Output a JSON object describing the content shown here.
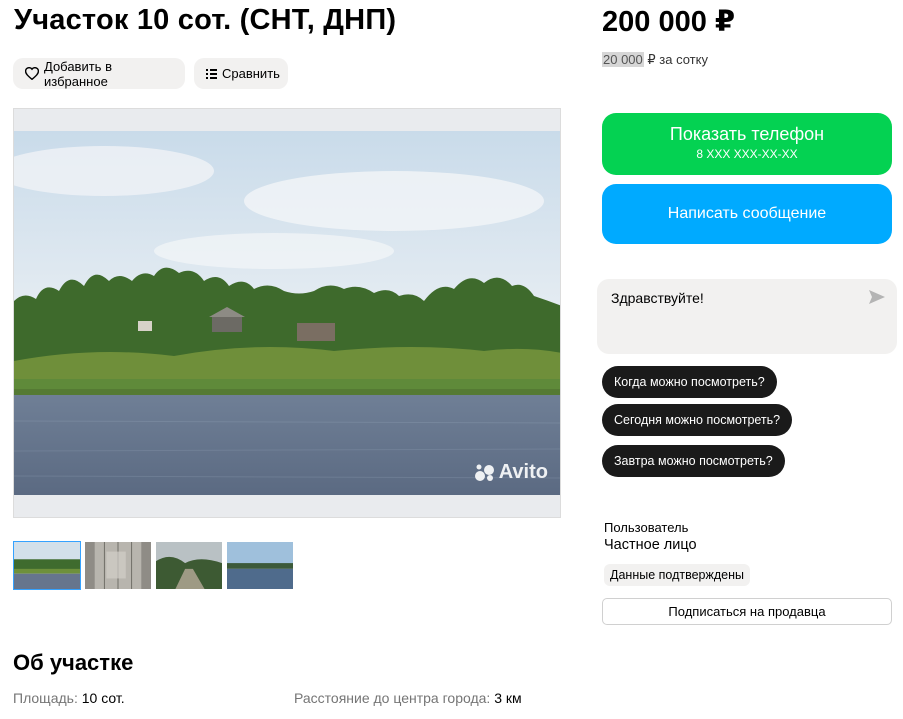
{
  "listing": {
    "title": "Участок 10 сот. (СНТ, ДНП)",
    "favorite_label": "Добавить в избранное",
    "compare_label": "Сравнить",
    "watermark": "Avito",
    "thumbnail_count": 4,
    "active_thumbnail": 1
  },
  "pricing": {
    "price": "200 000 ₽",
    "per_unit_value": "20 000",
    "per_unit_suffix": "₽ за сотку"
  },
  "contact": {
    "phone_button_label": "Показать телефон",
    "phone_masked": "8 XXX XXX-XX-XX",
    "message_button_label": "Написать сообщение",
    "chat_draft": "Здравствуйте!",
    "quick_replies": [
      "Когда можно посмотреть?",
      "Сегодня можно посмотреть?",
      "Завтра можно посмотреть?"
    ]
  },
  "seller": {
    "role": "Пользователь",
    "name": "Частное лицо",
    "verified_badge": "Данные подтверждены",
    "subscribe_label": "Подписаться на продавца"
  },
  "about": {
    "section_title": "Об участке",
    "params": [
      {
        "label": "Площадь:",
        "value": "10 сот."
      },
      {
        "label": "Расстояние до центра города:",
        "value": "3 км"
      }
    ]
  },
  "colors": {
    "phone_button": "#04d252",
    "message_button": "#00aaff",
    "quick_reply_bg": "#1a1a1a",
    "chip_bg": "#f2f1f0",
    "thumb_active_border": "#35a2ff"
  }
}
